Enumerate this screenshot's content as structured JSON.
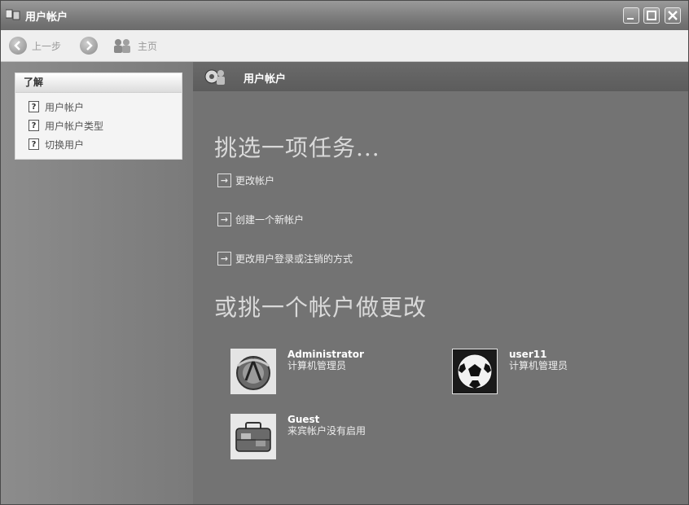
{
  "window": {
    "title": "用户帐户"
  },
  "toolbar": {
    "back_label": "上一步",
    "home_label": "主页"
  },
  "learn": {
    "header": "了解",
    "items": [
      {
        "label": "用户帐户"
      },
      {
        "label": "用户帐户类型"
      },
      {
        "label": "切换用户"
      }
    ]
  },
  "main": {
    "header_title": "用户帐户",
    "task_heading": "挑选一项任务...",
    "tasks": [
      {
        "label": "更改帐户"
      },
      {
        "label": "创建一个新帐户"
      },
      {
        "label": "更改用户登录或注销的方式"
      }
    ],
    "account_heading": "或挑一个帐户做更改",
    "accounts": [
      {
        "name": "Administrator",
        "type": "计算机管理员",
        "avatar": "badge-icon"
      },
      {
        "name": "user11",
        "type": "计算机管理员",
        "avatar": "soccer-ball-icon"
      },
      {
        "name": "Guest",
        "type": "来宾帐户没有启用",
        "avatar": "suitcase-icon"
      }
    ]
  }
}
